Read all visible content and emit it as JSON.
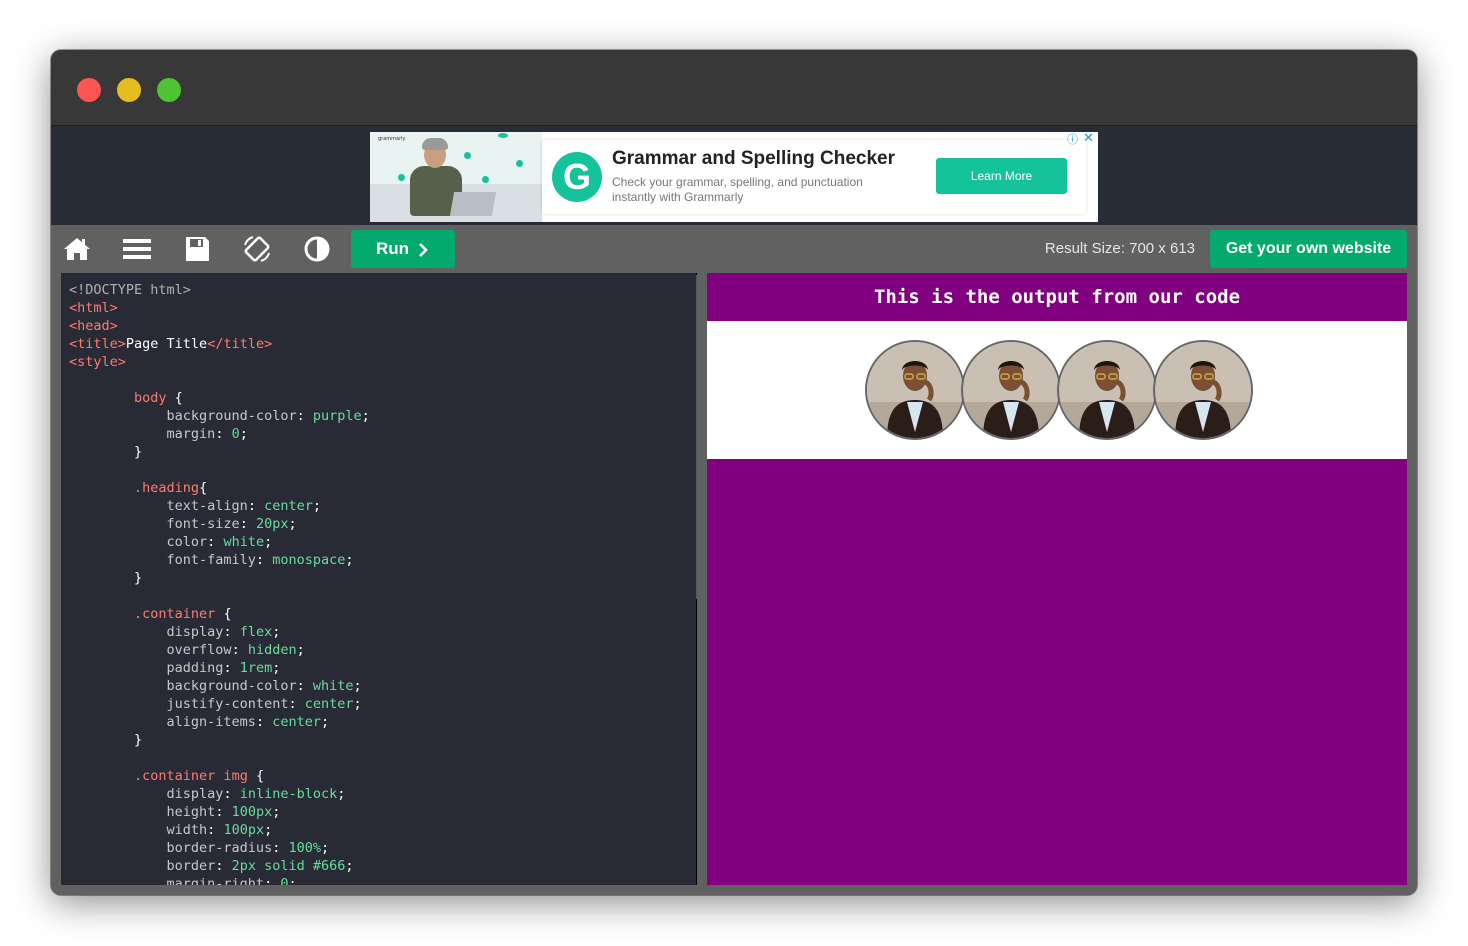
{
  "window": {
    "controls": [
      "close",
      "minimize",
      "zoom"
    ]
  },
  "ad": {
    "brand": "grammarly",
    "title": "Grammar and Spelling Checker",
    "description": "Check your grammar, spelling, and punctuation instantly with Grammarly",
    "cta_label": "Learn More",
    "logo_letter": "G",
    "info_glyph": "ⓘ",
    "close_glyph": "✕",
    "accent": "#15c39a"
  },
  "toolbar": {
    "icons": [
      "home-icon",
      "menu-icon",
      "save-icon",
      "rotate-icon",
      "contrast-icon"
    ],
    "run_label": "Run",
    "result_size": "Result Size: 700 x 613",
    "get_site_label": "Get your own website",
    "accent": "#04aa6d"
  },
  "editor": {
    "lines": [
      [
        {
          "c": "t-doc",
          "t": "<!DOCTYPE html>"
        }
      ],
      [
        {
          "c": "t-tag",
          "t": "<html>"
        }
      ],
      [
        {
          "c": "t-tag",
          "t": "<head>"
        }
      ],
      [
        {
          "c": "t-tag",
          "t": "<title>"
        },
        {
          "c": "t-txt",
          "t": "Page Title"
        },
        {
          "c": "t-tag",
          "t": "</title>"
        }
      ],
      [
        {
          "c": "t-tag",
          "t": "<style>"
        }
      ],
      [],
      [
        {
          "c": "t-txt",
          "t": "        "
        },
        {
          "c": "t-sel",
          "t": "body"
        },
        {
          "c": "t-txt",
          "t": " {"
        }
      ],
      [
        {
          "c": "t-prop",
          "t": "            background-color"
        },
        {
          "c": "t-txt",
          "t": ": "
        },
        {
          "c": "t-val",
          "t": "purple"
        },
        {
          "c": "t-txt",
          "t": ";"
        }
      ],
      [
        {
          "c": "t-prop",
          "t": "            margin"
        },
        {
          "c": "t-txt",
          "t": ": "
        },
        {
          "c": "t-val",
          "t": "0"
        },
        {
          "c": "t-txt",
          "t": ";"
        }
      ],
      [
        {
          "c": "t-txt",
          "t": "        }"
        }
      ],
      [],
      [
        {
          "c": "t-txt",
          "t": "        "
        },
        {
          "c": "t-sel",
          "t": ".heading"
        },
        {
          "c": "t-txt",
          "t": "{"
        }
      ],
      [
        {
          "c": "t-prop",
          "t": "            text-align"
        },
        {
          "c": "t-txt",
          "t": ": "
        },
        {
          "c": "t-val",
          "t": "center"
        },
        {
          "c": "t-txt",
          "t": ";"
        }
      ],
      [
        {
          "c": "t-prop",
          "t": "            font-size"
        },
        {
          "c": "t-txt",
          "t": ": "
        },
        {
          "c": "t-val",
          "t": "20px"
        },
        {
          "c": "t-txt",
          "t": ";"
        }
      ],
      [
        {
          "c": "t-prop",
          "t": "            color"
        },
        {
          "c": "t-txt",
          "t": ": "
        },
        {
          "c": "t-val",
          "t": "white"
        },
        {
          "c": "t-txt",
          "t": ";"
        }
      ],
      [
        {
          "c": "t-prop",
          "t": "            font-family"
        },
        {
          "c": "t-txt",
          "t": ": "
        },
        {
          "c": "t-val",
          "t": "monospace"
        },
        {
          "c": "t-txt",
          "t": ";"
        }
      ],
      [
        {
          "c": "t-txt",
          "t": "        }"
        }
      ],
      [],
      [
        {
          "c": "t-txt",
          "t": "        "
        },
        {
          "c": "t-sel",
          "t": ".container"
        },
        {
          "c": "t-txt",
          "t": " {"
        }
      ],
      [
        {
          "c": "t-prop",
          "t": "            display"
        },
        {
          "c": "t-txt",
          "t": ": "
        },
        {
          "c": "t-val",
          "t": "flex"
        },
        {
          "c": "t-txt",
          "t": ";"
        }
      ],
      [
        {
          "c": "t-prop",
          "t": "            overflow"
        },
        {
          "c": "t-txt",
          "t": ": "
        },
        {
          "c": "t-val",
          "t": "hidden"
        },
        {
          "c": "t-txt",
          "t": ";"
        }
      ],
      [
        {
          "c": "t-prop",
          "t": "            padding"
        },
        {
          "c": "t-txt",
          "t": ": "
        },
        {
          "c": "t-val",
          "t": "1rem"
        },
        {
          "c": "t-txt",
          "t": ";"
        }
      ],
      [
        {
          "c": "t-prop",
          "t": "            background-color"
        },
        {
          "c": "t-txt",
          "t": ": "
        },
        {
          "c": "t-val",
          "t": "white"
        },
        {
          "c": "t-txt",
          "t": ";"
        }
      ],
      [
        {
          "c": "t-prop",
          "t": "            justify-content"
        },
        {
          "c": "t-txt",
          "t": ": "
        },
        {
          "c": "t-val",
          "t": "center"
        },
        {
          "c": "t-txt",
          "t": ";"
        }
      ],
      [
        {
          "c": "t-prop",
          "t": "            align-items"
        },
        {
          "c": "t-txt",
          "t": ": "
        },
        {
          "c": "t-val",
          "t": "center"
        },
        {
          "c": "t-txt",
          "t": ";"
        }
      ],
      [
        {
          "c": "t-txt",
          "t": "        }"
        }
      ],
      [],
      [
        {
          "c": "t-txt",
          "t": "        "
        },
        {
          "c": "t-sel",
          "t": ".container img"
        },
        {
          "c": "t-txt",
          "t": " {"
        }
      ],
      [
        {
          "c": "t-prop",
          "t": "            display"
        },
        {
          "c": "t-txt",
          "t": ": "
        },
        {
          "c": "t-val",
          "t": "inline-block"
        },
        {
          "c": "t-txt",
          "t": ";"
        }
      ],
      [
        {
          "c": "t-prop",
          "t": "            height"
        },
        {
          "c": "t-txt",
          "t": ": "
        },
        {
          "c": "t-val",
          "t": "100px"
        },
        {
          "c": "t-txt",
          "t": ";"
        }
      ],
      [
        {
          "c": "t-prop",
          "t": "            width"
        },
        {
          "c": "t-txt",
          "t": ": "
        },
        {
          "c": "t-val",
          "t": "100px"
        },
        {
          "c": "t-txt",
          "t": ";"
        }
      ],
      [
        {
          "c": "t-prop",
          "t": "            border-radius"
        },
        {
          "c": "t-txt",
          "t": ": "
        },
        {
          "c": "t-val",
          "t": "100%"
        },
        {
          "c": "t-txt",
          "t": ";"
        }
      ],
      [
        {
          "c": "t-prop",
          "t": "            border"
        },
        {
          "c": "t-txt",
          "t": ": "
        },
        {
          "c": "t-val",
          "t": "2px solid #666"
        },
        {
          "c": "t-txt",
          "t": ";"
        }
      ],
      [
        {
          "c": "t-prop",
          "t": "            margin-right"
        },
        {
          "c": "t-txt",
          "t": ": "
        },
        {
          "c": "t-val",
          "t": "0"
        },
        {
          "c": "t-txt",
          "t": ";"
        }
      ]
    ]
  },
  "preview": {
    "heading": "This is the output from our code",
    "background": "#800080",
    "avatar_count": 4
  }
}
